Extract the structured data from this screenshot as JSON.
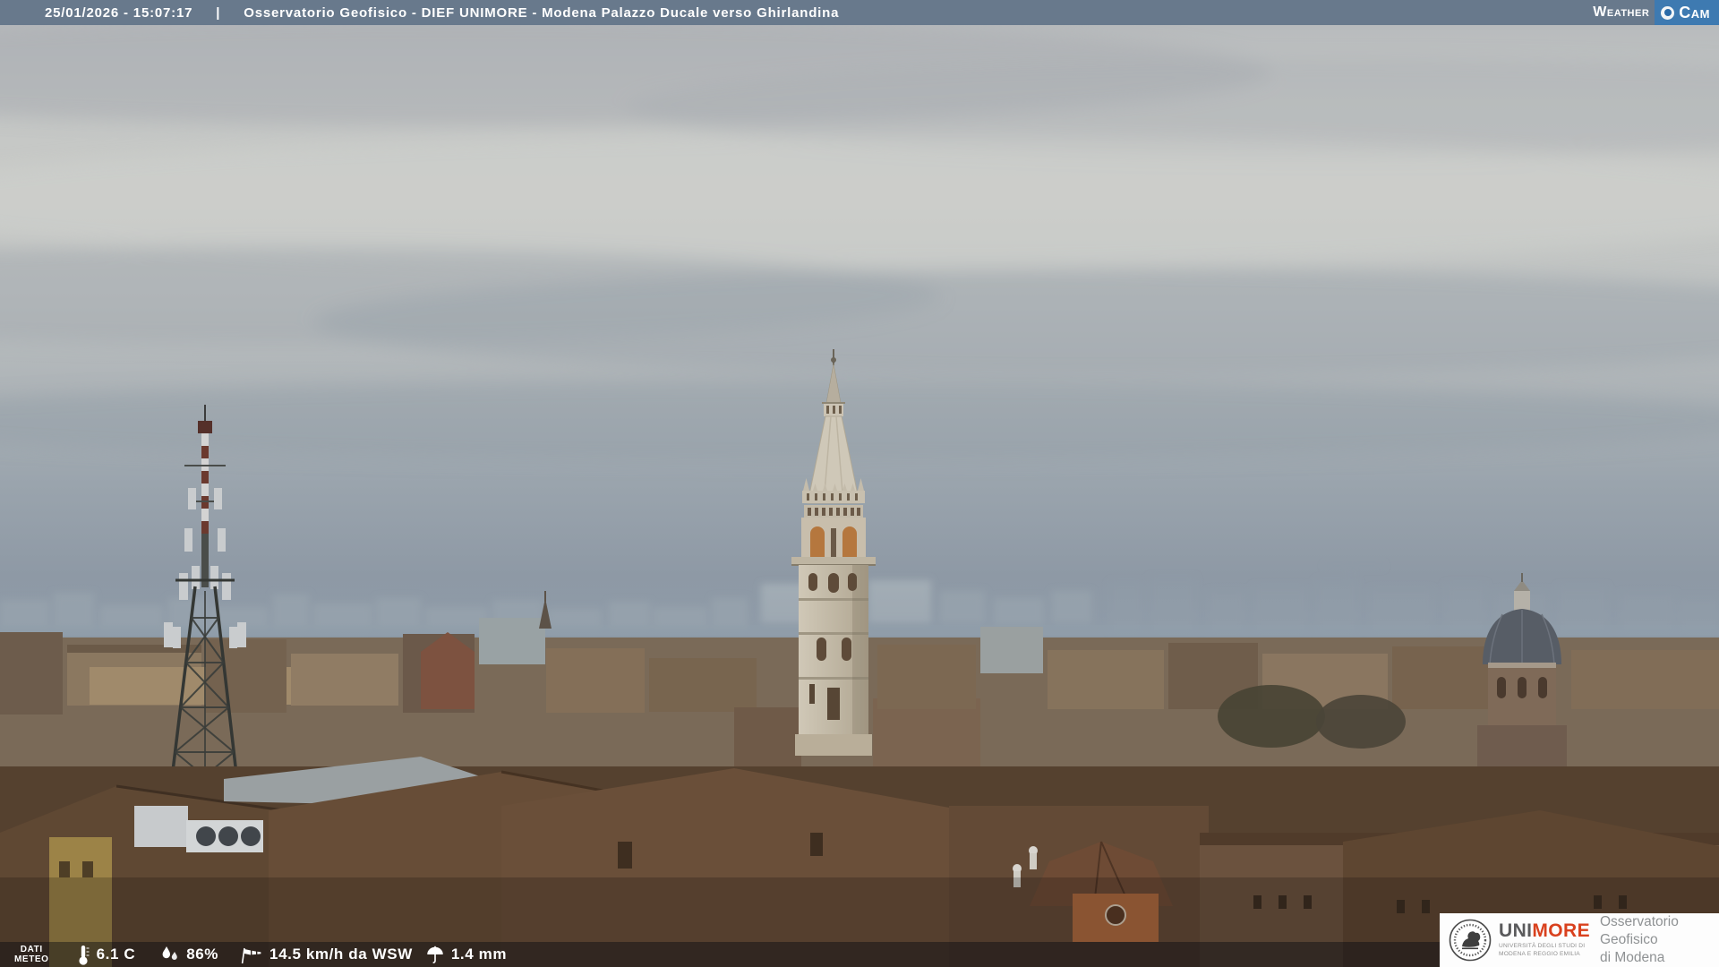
{
  "top_bar": {
    "datetime": "25/01/2026 - 15:07:17",
    "separator": "|",
    "title": "Osservatorio Geofisico - DIEF UNIMORE - Modena Palazzo Ducale verso Ghirlandina",
    "logo_weather": "Weather",
    "logo_cam": "Cam"
  },
  "bottom_bar": {
    "label_line1": "DATI",
    "label_line2": "METEO",
    "temperature": "6.1 C",
    "humidity": "86%",
    "wind": "14.5 km/h da WSW",
    "rain": "1.4 mm"
  },
  "logo_box": {
    "uni": "UNI",
    "more": "MORE",
    "subtitle_line1": "UNIVERSITÀ DEGLI STUDI DI",
    "subtitle_line2": "MODENA E REGGIO EMILIA",
    "title_line1": "Osservatorio Geofisico",
    "title_line2": "di Modena"
  },
  "icons": [
    "thermometer-icon",
    "humidity-icon",
    "windsock-icon",
    "umbrella-icon",
    "camera-lens-icon",
    "unimore-seal"
  ],
  "colors": {
    "top_bar_bg": "#68798c",
    "weathercam_blue": "#3e7ab1",
    "unimore_red": "#d9411e",
    "bottom_bar_bg": "rgba(8,12,18,0.45)"
  }
}
